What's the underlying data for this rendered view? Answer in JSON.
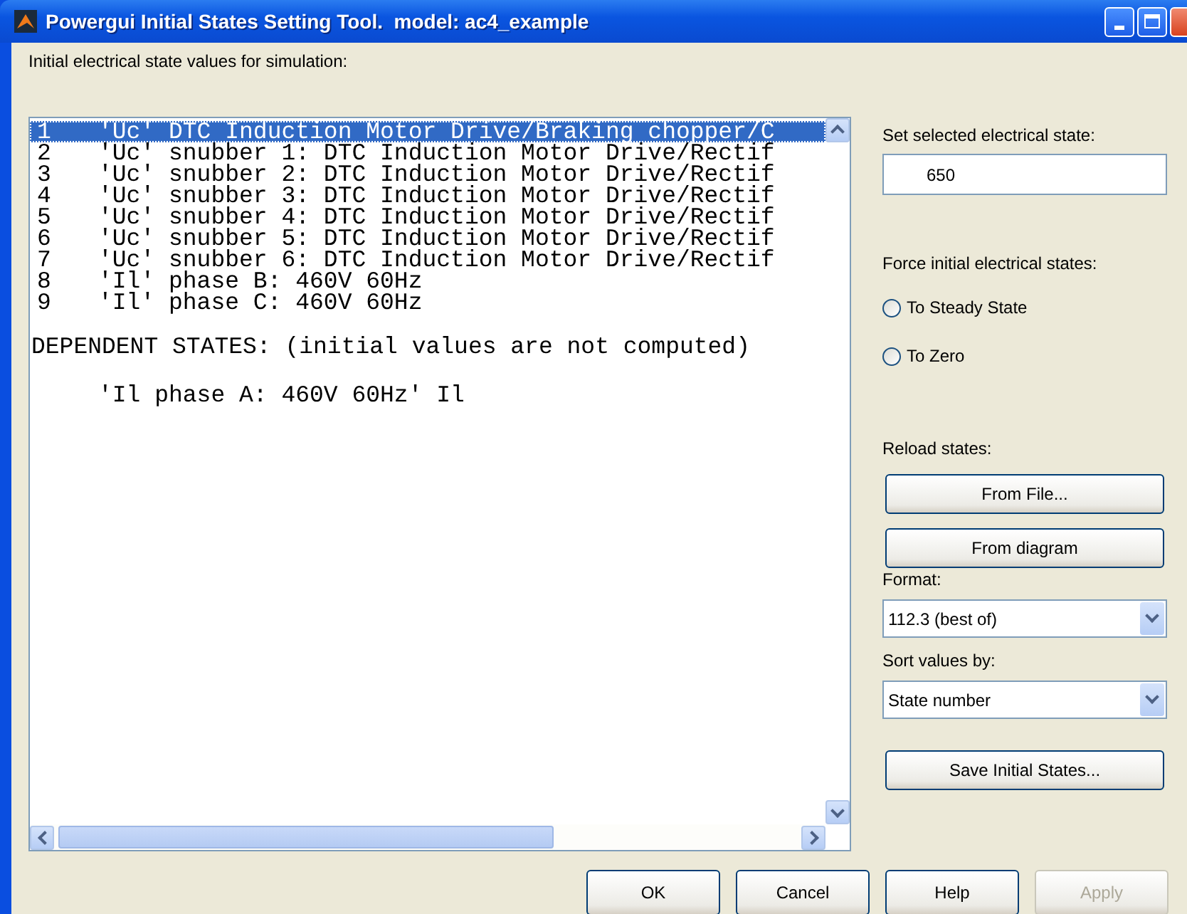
{
  "window": {
    "title": "Powergui Initial States Setting Tool.  model: ac4_example"
  },
  "list_label": "Initial electrical state values for simulation:",
  "states": [
    {
      "number": "1",
      "text": "'Uc' DTC Induction Motor Drive/Braking chopper/C",
      "selected": true
    },
    {
      "number": "2",
      "text": "'Uc' snubber 1: DTC Induction Motor Drive/Rectif",
      "selected": false
    },
    {
      "number": "3",
      "text": "'Uc' snubber 2: DTC Induction Motor Drive/Rectif",
      "selected": false
    },
    {
      "number": "4",
      "text": "'Uc' snubber 3: DTC Induction Motor Drive/Rectif",
      "selected": false
    },
    {
      "number": "5",
      "text": "'Uc' snubber 4: DTC Induction Motor Drive/Rectif",
      "selected": false
    },
    {
      "number": "6",
      "text": "'Uc' snubber 5: DTC Induction Motor Drive/Rectif",
      "selected": false
    },
    {
      "number": "7",
      "text": "'Uc' snubber 6: DTC Induction Motor Drive/Rectif",
      "selected": false
    },
    {
      "number": "8",
      "text": "'Il' phase B: 460V 60Hz",
      "selected": false
    },
    {
      "number": "9",
      "text": "'Il' phase C: 460V 60Hz",
      "selected": false
    }
  ],
  "dependent_header": "DEPENDENT STATES: (initial values are not computed)",
  "dependent_states": [
    "'Il phase A: 460V 60Hz' Il"
  ],
  "set_state": {
    "label": "Set selected electrical state:",
    "value": "650"
  },
  "force": {
    "label": "Force initial electrical states:",
    "options": [
      {
        "label": "To Steady State",
        "checked": false
      },
      {
        "label": "To Zero",
        "checked": false
      }
    ]
  },
  "reload": {
    "label": "Reload states:",
    "buttons": [
      "From File...",
      "From diagram"
    ]
  },
  "format": {
    "label": "Format:",
    "value": "112.3 (best of)"
  },
  "sort": {
    "label": "Sort values by:",
    "value": "State number"
  },
  "save_button": "Save Initial States...",
  "buttons": [
    {
      "label": "OK",
      "disabled": false
    },
    {
      "label": "Cancel",
      "disabled": false
    },
    {
      "label": "Help",
      "disabled": false
    },
    {
      "label": "Apply",
      "disabled": true
    }
  ]
}
